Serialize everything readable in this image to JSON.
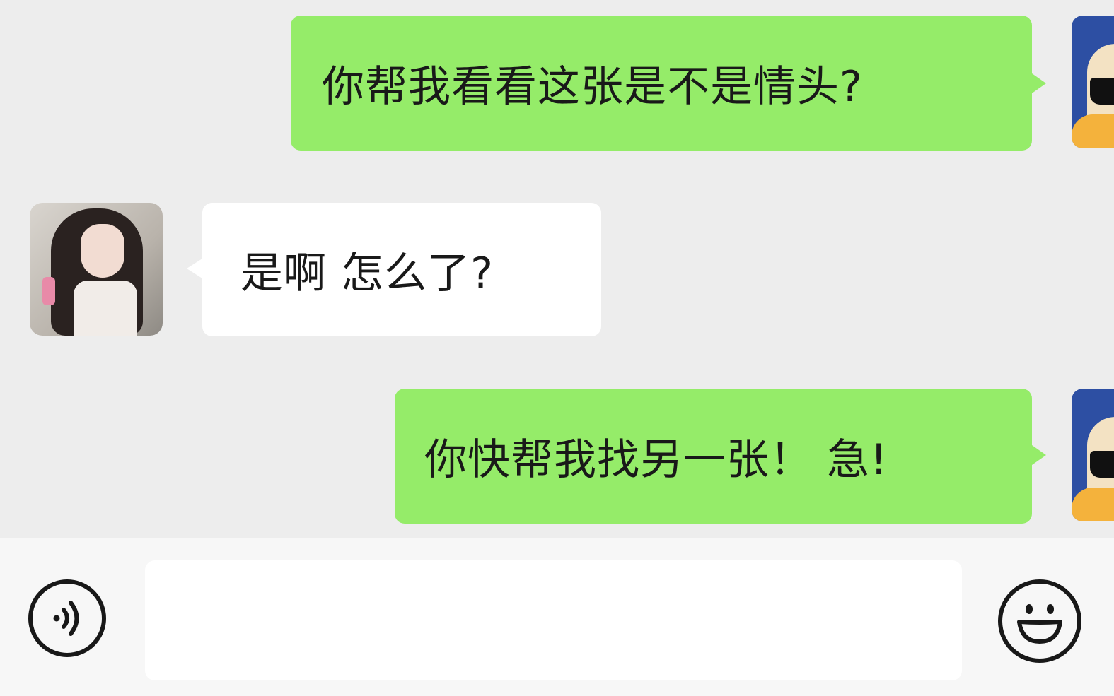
{
  "messages": [
    {
      "sender": "self",
      "text": "你帮我看看这张是不是情头?"
    },
    {
      "sender": "other",
      "text": "是啊 怎么了?"
    },
    {
      "sender": "self",
      "text": "你快帮我找另一张！ 急!"
    }
  ],
  "input_bar": {
    "input_value": "",
    "voice_icon": "voice-icon",
    "emoji_icon": "emoji-icon"
  },
  "colors": {
    "chat_background": "#ededed",
    "self_bubble": "#95ec69",
    "other_bubble": "#ffffff",
    "input_bar_background": "#f7f7f7"
  }
}
